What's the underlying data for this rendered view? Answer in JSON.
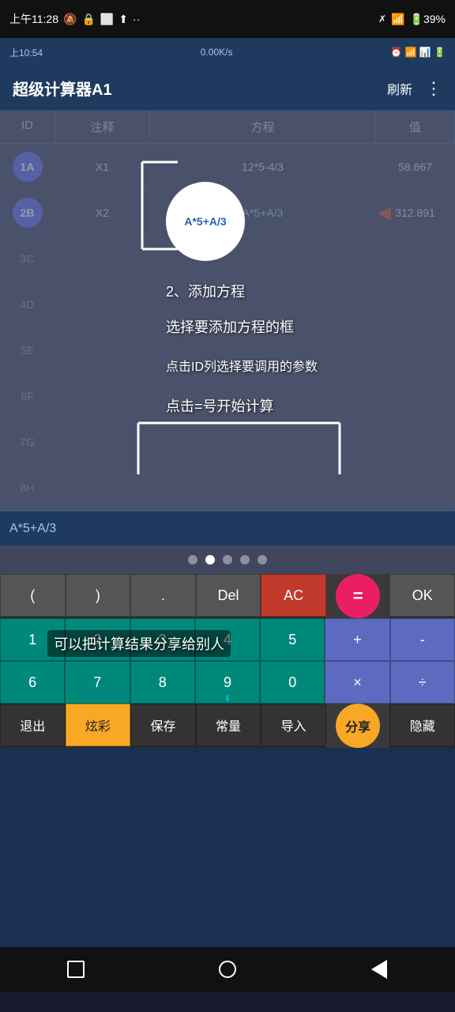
{
  "statusBar": {
    "time": "上午11:28",
    "icons": [
      "mute",
      "security",
      "square",
      "upload",
      "dots"
    ],
    "rightIcons": [
      "blocked",
      "wifi",
      "battery"
    ],
    "batteryLevel": "39"
  },
  "appStatusBar": {
    "time": "上10:54",
    "network": "0.00K/s",
    "rightIcons": [
      "clock",
      "wifi",
      "signal1",
      "signal2",
      "battery"
    ]
  },
  "header": {
    "title": "超级计算器A1",
    "refreshLabel": "刷新",
    "menuIcon": "⋮"
  },
  "table": {
    "columns": [
      "ID",
      "注释",
      "方程",
      "值"
    ],
    "rows": [
      {
        "id": "1A",
        "note": "X1",
        "equation": "12*5-4/3",
        "value": "58.667",
        "hasArrow": false
      },
      {
        "id": "2B",
        "note": "X2",
        "equation": "A*5+A/3",
        "value": "312.891",
        "hasArrow": true
      },
      {
        "id": "3C",
        "note": "",
        "equation": "",
        "value": "",
        "hasArrow": false
      },
      {
        "id": "4D",
        "note": "",
        "equation": "",
        "value": "",
        "hasArrow": false
      },
      {
        "id": "5E",
        "note": "",
        "equation": "",
        "value": "",
        "hasArrow": false
      },
      {
        "id": "6F",
        "note": "",
        "equation": "",
        "value": "",
        "hasArrow": false
      },
      {
        "id": "7G",
        "note": "",
        "equation": "",
        "value": "",
        "hasArrow": false
      },
      {
        "id": "8H",
        "note": "",
        "equation": "",
        "value": "",
        "hasArrow": false
      }
    ]
  },
  "tutorial": {
    "circleText": "A*5+A/3",
    "step1": "2、添加方程",
    "step2": "选择要添加方程的框",
    "step3": "点击ID列选择要调用的参数",
    "step4": "点击=号开始计算",
    "shareHint": "可以把计算结果分享给别人"
  },
  "formulaBar": {
    "text": "A*5+A/3"
  },
  "pageDots": {
    "count": 5,
    "activeIndex": 1
  },
  "keyboard": {
    "row1": [
      "(",
      ")",
      ".",
      "Del",
      "AC",
      "=",
      "OK"
    ],
    "row2": [
      "1",
      "2",
      "3",
      "4",
      "5",
      "+",
      "-"
    ],
    "row3": [
      "6",
      "7",
      "8",
      "9",
      "0",
      "×",
      "÷"
    ],
    "row4": [
      "退出",
      "炫彩",
      "保存",
      "常量",
      "导入",
      "分享",
      "隐藏"
    ]
  },
  "colors": {
    "appBg": "#1a3050",
    "headerBg": "#1e3a5f",
    "tableBorder": "#243a55",
    "idBadge": "#3a5aff",
    "arrowRed": "#c0392b",
    "keyGray": "#555555",
    "keyTeal": "#00897b",
    "keyRed": "#c0392b",
    "keyEquals": "#e91e63",
    "keyGold": "#f9a825",
    "keyPurple": "#5c6bc0"
  }
}
